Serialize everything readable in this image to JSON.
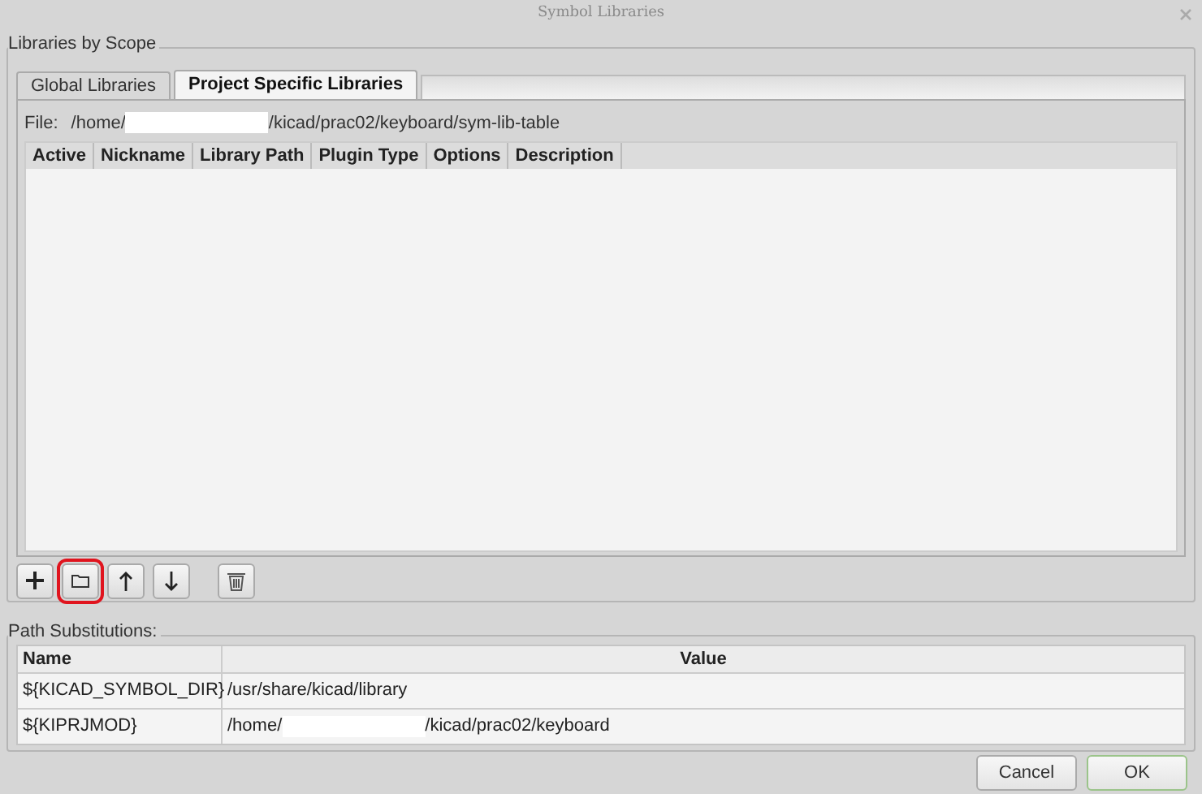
{
  "window": {
    "title": "Symbol Libraries"
  },
  "scope_group": {
    "label": "Libraries by Scope"
  },
  "tabs": [
    {
      "label": "Global Libraries",
      "selected": false
    },
    {
      "label": "Project Specific Libraries",
      "selected": true
    }
  ],
  "file": {
    "label": "File:",
    "path_start": "/home/",
    "path_end": "/kicad/prac02/keyboard/sym-lib-table",
    "redacted": true
  },
  "library_table": {
    "columns": [
      "Active",
      "Nickname",
      "Library Path",
      "Plugin Type",
      "Options",
      "Description"
    ]
  },
  "toolbar": [
    {
      "kind": "add",
      "highlighted": false
    },
    {
      "kind": "browse",
      "highlighted": true
    },
    {
      "kind": "up",
      "highlighted": false
    },
    {
      "kind": "down",
      "highlighted": false
    },
    {
      "kind": "delete",
      "highlighted": false
    }
  ],
  "path_group": {
    "label": "Path Substitutions:"
  },
  "path_table": {
    "columns": [
      "Name",
      "Value"
    ],
    "rows": [
      {
        "name": "${KICAD_SYMBOL_DIR}",
        "value_start": "/usr/share/kicad/library"
      },
      {
        "name": "${KIPRJMOD}",
        "value_start": "/home/",
        "value_end": "/kicad/prac02/keyboard",
        "redacted": true
      }
    ]
  },
  "buttons": [
    {
      "label": "Cancel",
      "default": false
    },
    {
      "label": "OK",
      "default": true
    }
  ]
}
